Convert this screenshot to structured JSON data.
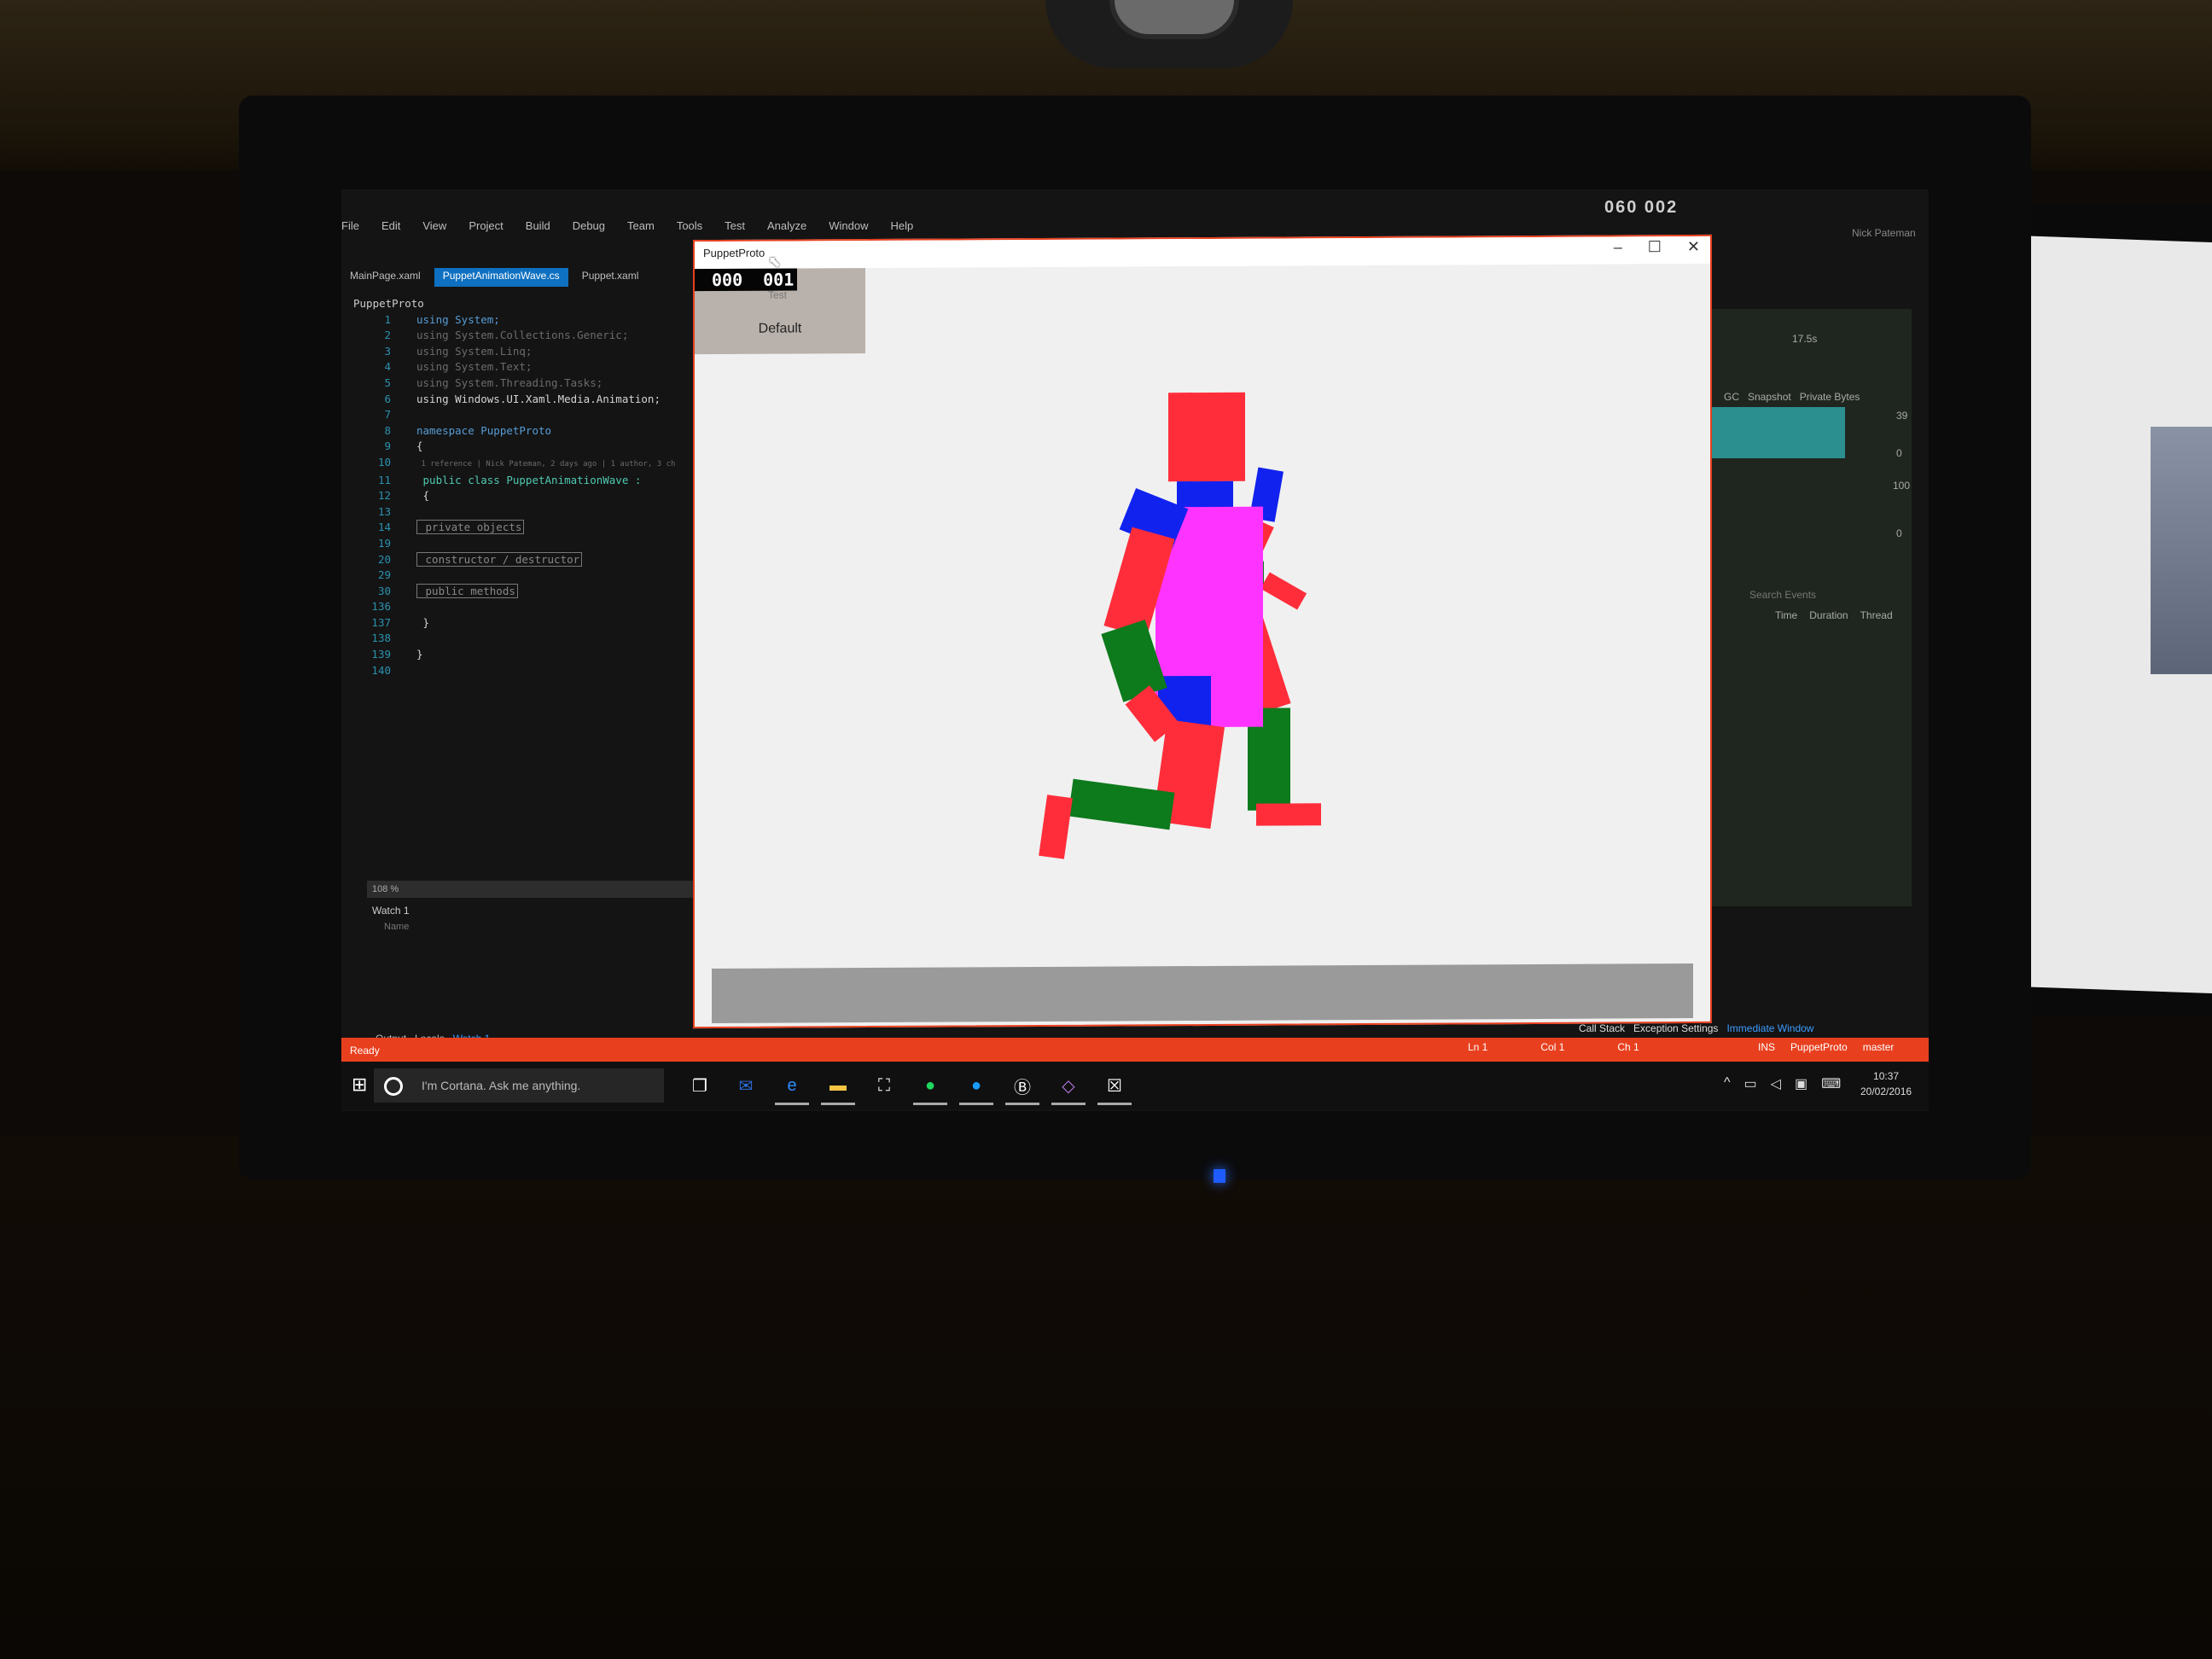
{
  "ide": {
    "menu": [
      "File",
      "Edit",
      "View",
      "Project",
      "Build",
      "Debug",
      "Team",
      "Tools",
      "Test",
      "Analyze",
      "Window",
      "Help"
    ],
    "top_right_counter": "060  002",
    "user": "Nick Pateman",
    "tabs": [
      "MainPage.xaml",
      "PuppetAnimationWave.cs",
      "Puppet.xaml"
    ],
    "project": "PuppetProto",
    "code": [
      {
        "ln": "1",
        "text": "using System;"
      },
      {
        "ln": "2",
        "text": "using System.Collections.Generic;"
      },
      {
        "ln": "3",
        "text": "using System.Linq;"
      },
      {
        "ln": "4",
        "text": "using System.Text;"
      },
      {
        "ln": "5",
        "text": "using System.Threading.Tasks;"
      },
      {
        "ln": "6",
        "text": "using Windows.UI.Xaml.Media.Animation;"
      },
      {
        "ln": "7",
        "text": ""
      },
      {
        "ln": "8",
        "text": "namespace PuppetProto"
      },
      {
        "ln": "9",
        "text": "{"
      },
      {
        "ln": "10",
        "text": "    1 reference | Nick Pateman, 2 days ago | 1 author, 3 ch"
      },
      {
        "ln": "11",
        "text": "    public class PuppetAnimationWave :"
      },
      {
        "ln": "12",
        "text": "    {"
      },
      {
        "ln": "13",
        "text": ""
      },
      {
        "ln": "14",
        "text": "        private objects"
      },
      {
        "ln": "19",
        "text": ""
      },
      {
        "ln": "20",
        "text": "        constructor / destructor"
      },
      {
        "ln": "29",
        "text": ""
      },
      {
        "ln": "30",
        "text": "        public methods"
      },
      {
        "ln": "136",
        "text": ""
      },
      {
        "ln": "137",
        "text": "    }"
      },
      {
        "ln": "138",
        "text": ""
      },
      {
        "ln": "139",
        "text": "}"
      },
      {
        "ln": "140",
        "text": ""
      }
    ],
    "zoom": "108 %",
    "watch_title": "Watch 1",
    "watch_column": "Name",
    "bottom_tabs": [
      "Output",
      "Locals",
      "Watch 1"
    ],
    "right_tabs": [
      "Call Stack",
      "Exception Settings",
      "Immediate Window"
    ],
    "status": {
      "ready": "Ready",
      "ln": "Ln 1",
      "col": "Col 1",
      "ch": "Ch 1",
      "ins": "INS",
      "project": "PuppetProto",
      "branch": "master"
    },
    "diagnostics": {
      "time_label": "17.5s",
      "legend": [
        "GC",
        "Snapshot",
        "Private Bytes"
      ],
      "values": [
        "39",
        "0",
        "100",
        "0"
      ],
      "search": "Search Events",
      "columns": [
        "Time",
        "Duration",
        "Thread"
      ]
    }
  },
  "app": {
    "title": "PuppetProto",
    "counter": [
      "000",
      "001"
    ],
    "test_label": "Test",
    "default_button": "Default"
  },
  "taskbar": {
    "cortana": "I'm Cortana. Ask me anything.",
    "time": "10:37",
    "date": "20/02/2016"
  },
  "colors": {
    "puppet_red": "#ff2d3a",
    "puppet_blue": "#1122ee",
    "puppet_pink": "#ff33ff",
    "puppet_green": "#0d7a1c",
    "status_bar": "#e8401f"
  }
}
